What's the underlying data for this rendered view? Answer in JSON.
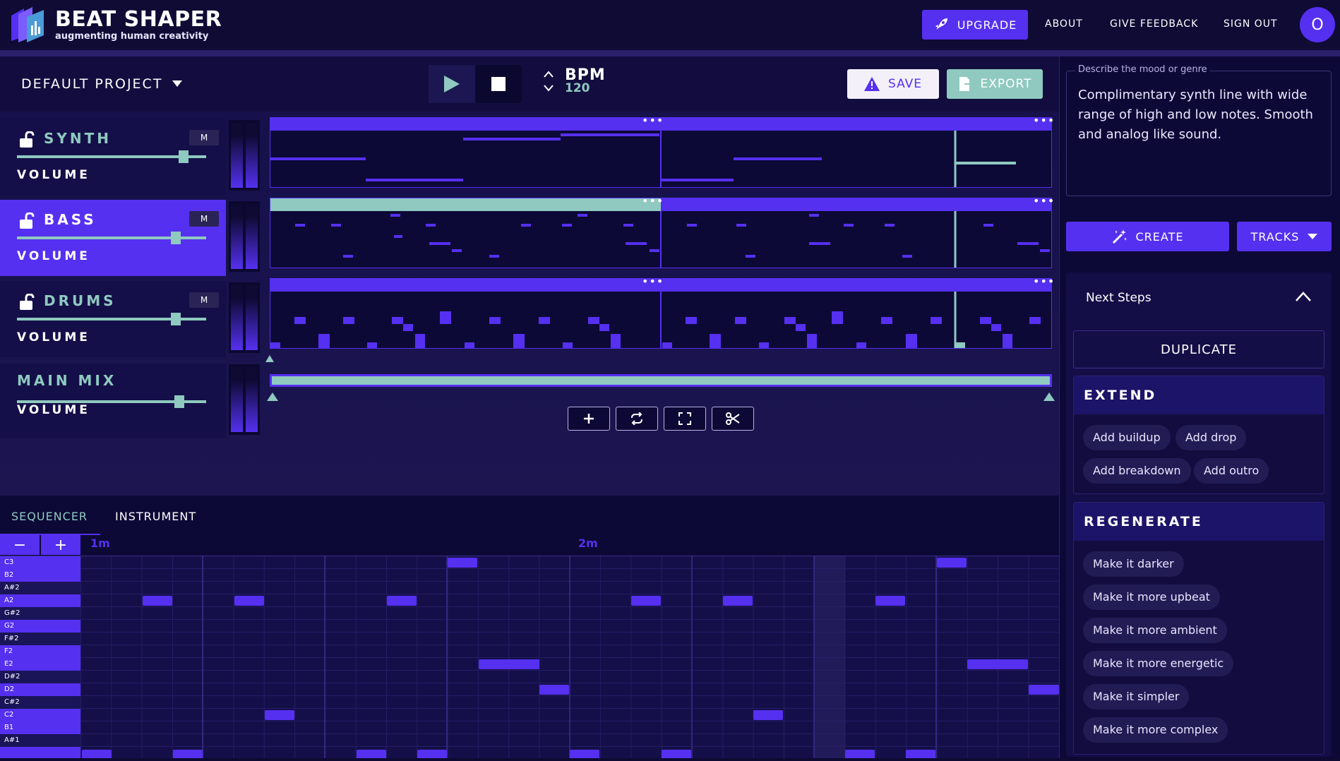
{
  "app": {
    "name": "BEAT SHAPER",
    "tagline": "augmenting human creativity"
  },
  "nav": {
    "upgrade": "UPGRADE",
    "about": "ABOUT",
    "feedback": "GIVE FEEDBACK",
    "signout": "SIGN OUT",
    "avatar": "O"
  },
  "project": {
    "name": "DEFAULT PROJECT"
  },
  "bpm": {
    "label": "BPM",
    "value": "120"
  },
  "toolbar": {
    "save": "SAVE",
    "export": "EXPORT"
  },
  "tracks": [
    {
      "name": "SYNTH",
      "mute": "M",
      "volume_label": "VOLUME",
      "volume": 0.88
    },
    {
      "name": "BASS",
      "mute": "M",
      "volume_label": "VOLUME",
      "volume": 0.84
    },
    {
      "name": "DRUMS",
      "mute": "M",
      "volume_label": "VOLUME",
      "volume": 0.84
    }
  ],
  "mainmix": {
    "name": "MAIN MIX",
    "volume_label": "VOLUME",
    "volume": 0.86
  },
  "lane_menu": "•••",
  "tabs": {
    "sequencer": "SEQUENCER",
    "instrument": "INSTRUMENT"
  },
  "zoom": {
    "out": "−",
    "in": "+"
  },
  "timeline": {
    "m1": "1m",
    "m2": "2m"
  },
  "piano_keys": [
    "C3",
    "B2",
    "A#2",
    "A2",
    "G#2",
    "G2",
    "F#2",
    "F2",
    "E2",
    "D#2",
    "D2",
    "C#2",
    "C2",
    "B1",
    "A#1"
  ],
  "mood": {
    "label": "Describe the mood or genre",
    "text": "Complimentary synth line with wide range of high and low notes. Smooth and analog like sound."
  },
  "actions": {
    "create": "CREATE",
    "tracks": "TRACKS"
  },
  "next_steps": {
    "title": "Next Steps",
    "duplicate": "DUPLICATE",
    "extend": {
      "title": "EXTEND",
      "chips": [
        "Add buildup",
        "Add drop",
        "Add breakdown",
        "Add outro"
      ]
    },
    "regenerate": {
      "title": "REGENERATE",
      "chips": [
        "Make it darker",
        "Make it more upbeat",
        "Make it more ambient",
        "Make it more energetic",
        "Make it simpler",
        "Make it more complex"
      ]
    }
  },
  "colors": {
    "accent": "#5530f0",
    "teal": "#8fc9c0",
    "bg": "#0e0a33"
  }
}
